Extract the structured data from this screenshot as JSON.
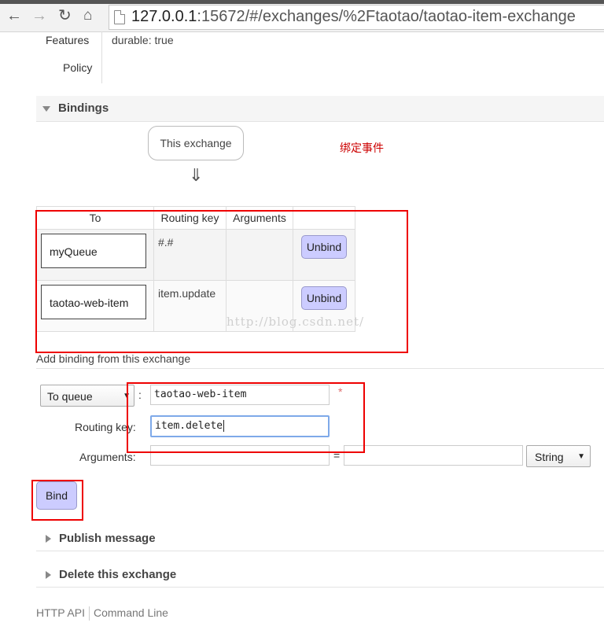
{
  "browser": {
    "url_host": "127.0.0.1",
    "url_rest": ":15672/#/exchanges/%2Ftaotao/taotao-item-exchange"
  },
  "details": {
    "features_label": "Features",
    "policy_label": "Policy",
    "features_value": "durable: true"
  },
  "bindings": {
    "section_title": "Bindings",
    "this_exchange": "This exchange",
    "arrow": "⇓",
    "annotation": "绑定事件",
    "columns": [
      "To",
      "Routing key",
      "Arguments"
    ],
    "rows": [
      {
        "to": "myQueue",
        "routing_key": "#.#",
        "arguments": "",
        "action": "Unbind"
      },
      {
        "to": "taotao-web-item",
        "routing_key": "item.update",
        "arguments": "",
        "action": "Unbind"
      }
    ],
    "watermark": "http://blog.csdn.net/"
  },
  "add_binding": {
    "title": "Add binding from this exchange",
    "destination_type": "To queue",
    "destination_value": "taotao-web-item",
    "required_mark": "*",
    "routing_key_label": "Routing key:",
    "routing_key_value": "item.delete",
    "arguments_label": "Arguments:",
    "arguments_key": "",
    "arguments_equals": "=",
    "arguments_value": "",
    "arguments_type": "String",
    "bind_button": "Bind"
  },
  "sections": {
    "publish": "Publish message",
    "delete": "Delete this exchange"
  },
  "footer": {
    "http_api": "HTTP API",
    "command_line": "Command Line"
  },
  "colors": {
    "button_bg": "#ccccff",
    "highlight_box": "#e00000",
    "annotation": "#cc0000"
  }
}
